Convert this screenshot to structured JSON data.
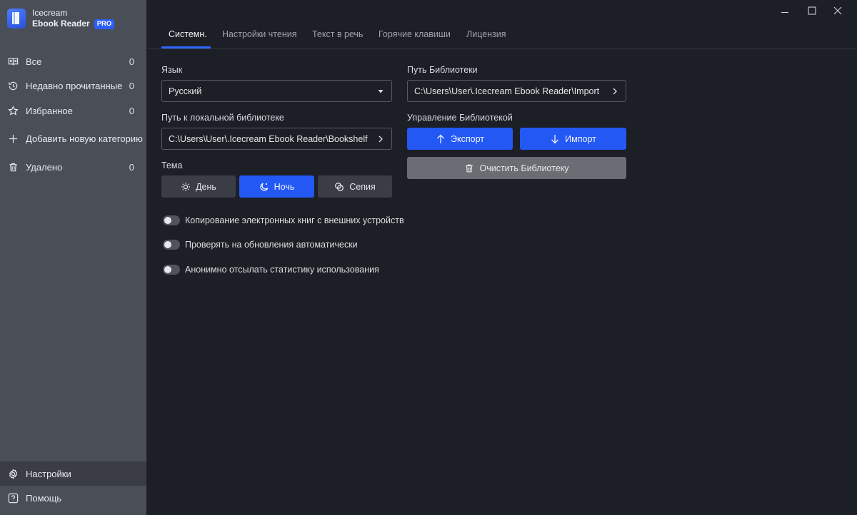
{
  "app": {
    "name_line1": "Icecream",
    "name_line2": "Ebook Reader",
    "badge": "PRO"
  },
  "sidebar": {
    "items": [
      {
        "label": "Все",
        "count": "0",
        "icon": "book-open-icon"
      },
      {
        "label": "Недавно прочитанные",
        "count": "0",
        "icon": "history-icon"
      },
      {
        "label": "Избранное",
        "count": "0",
        "icon": "star-icon"
      },
      {
        "label": "Добавить новую категорию",
        "icon": "plus-icon"
      },
      {
        "label": "Удалено",
        "count": "0",
        "icon": "trash-icon"
      }
    ],
    "bottom": [
      {
        "label": "Настройки",
        "icon": "gear-icon"
      },
      {
        "label": "Помощь",
        "icon": "help-icon"
      }
    ]
  },
  "tabs": [
    "Системн.",
    "Настройки чтения",
    "Текст в речь",
    "Горячие клавиши",
    "Лицензия"
  ],
  "settings": {
    "language": {
      "label": "Язык",
      "value": "Русский"
    },
    "local_library": {
      "label": "Путь к локальной библиотеке",
      "value": "C:\\Users\\User\\.Icecream Ebook Reader\\Bookshelf"
    },
    "theme": {
      "label": "Тема",
      "options": [
        "День",
        "Ночь",
        "Сепия"
      ],
      "selected": "Ночь"
    },
    "library_path": {
      "label": "Путь Библиотеки",
      "value": "C:\\Users\\User\\.Icecream Ebook Reader\\Import"
    },
    "library_management": {
      "label": "Управление Библиотекой",
      "export": "Экспорт",
      "import": "Импорт",
      "clear": "Очистить Библиотеку"
    },
    "toggles": [
      {
        "label": "Копирование электронных книг с внешних устройств",
        "on": false
      },
      {
        "label": "Проверять на обновления автоматически",
        "on": false
      },
      {
        "label": "Анонимно отсылать статистику использования",
        "on": false
      }
    ]
  },
  "colors": {
    "accent": "#2358f4",
    "sidebar": "#4a4e57",
    "background": "#1d1f26"
  }
}
